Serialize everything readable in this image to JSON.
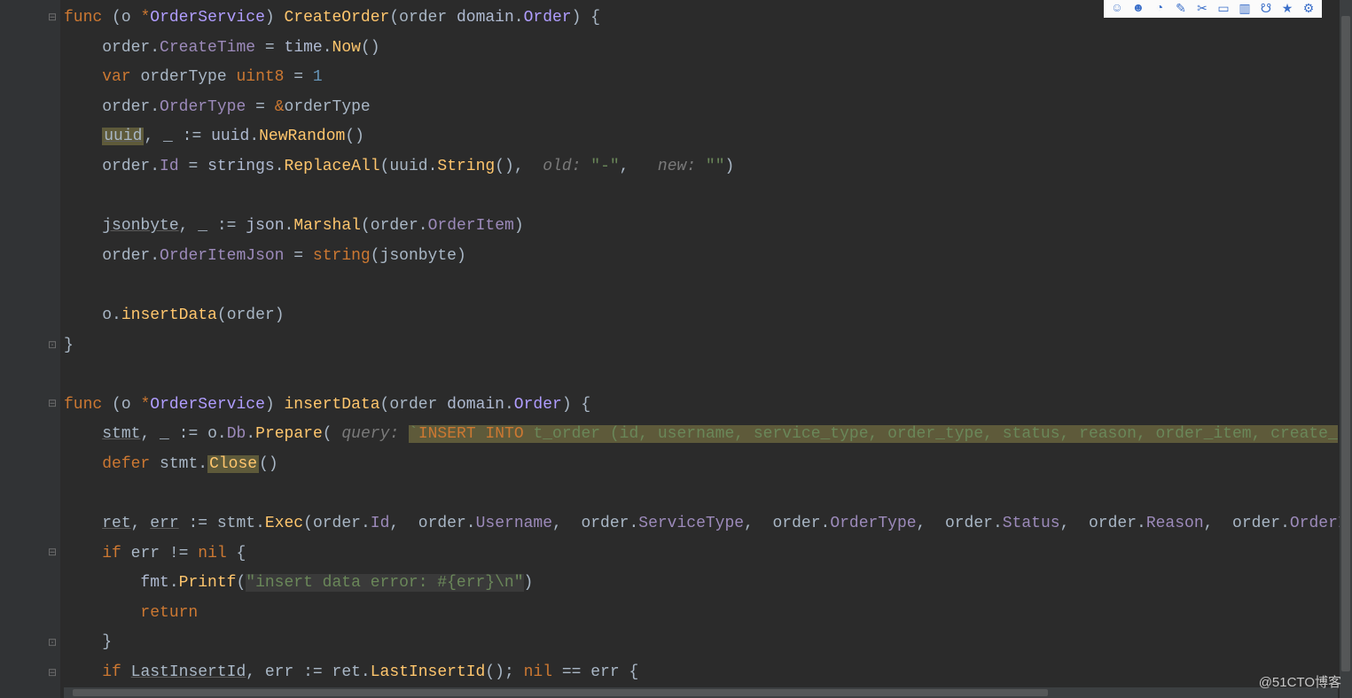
{
  "watermark": "@51CTO博客",
  "toolbar_icons": [
    "face-icon",
    "smile-icon",
    "clock-icon",
    "pencil-icon",
    "scissors-icon",
    "clipboard-icon",
    "inbox-icon",
    "people-icon",
    "star-icon",
    "gear-icon"
  ],
  "tokens": {
    "func": "func",
    "o": "o",
    "star": "*",
    "OrderService": "OrderService",
    "CreateOrder": "CreateOrder",
    "insertData": "insertData",
    "order": "order",
    "domain": "domain",
    "Order": "Order",
    "brace_o": "{",
    "brace_c": "}",
    "CreateTime": "CreateTime",
    "eq": "=",
    "time": "time",
    "Now": "Now",
    "paren": "()",
    "var": "var",
    "orderType": "orderType",
    "uint8": "uint8",
    "one": "1",
    "OrderType": "OrderType",
    "amp": "&",
    "uuid": "uuid",
    "underscore": "_",
    "walrus": ":=",
    "NewRandom": "NewRandom",
    "Id": "Id",
    "strings": "strings",
    "ReplaceAll": "ReplaceAll",
    "String": "String",
    "old": "old:",
    "dash": "\"-\"",
    "new": "new:",
    "empty": "\"\"",
    "jsonbyte": "jsonbyte",
    "json": "json",
    "Marshal": "Marshal",
    "OrderItem": "OrderItem",
    "OrderItemJson": "OrderItemJson",
    "stringfn": "string",
    "stmt": "stmt",
    "Db": "Db",
    "Prepare": "Prepare",
    "query": "query:",
    "sql_insert": "INSERT INTO",
    "sql_rest": " t_order (id, username, service_type, order_type, status, reason, order_item, create_",
    "defer": "defer",
    "Close": "Close",
    "ret": "ret",
    "err": "err",
    "Exec": "Exec",
    "Username": "Username",
    "ServiceType": "ServiceType",
    "Status": "Status",
    "Reason": "Reason",
    "OrderItemJ": "OrderItemJ",
    "if": "if",
    "neq": "!=",
    "nil": "nil",
    "fmt": "fmt",
    "Printf": "Printf",
    "errstr": "\"insert data error: #{err}\\n\"",
    "return": "return",
    "LastInsertId": "LastInsertId",
    "eqeq": "==",
    "semicolon": ";"
  }
}
